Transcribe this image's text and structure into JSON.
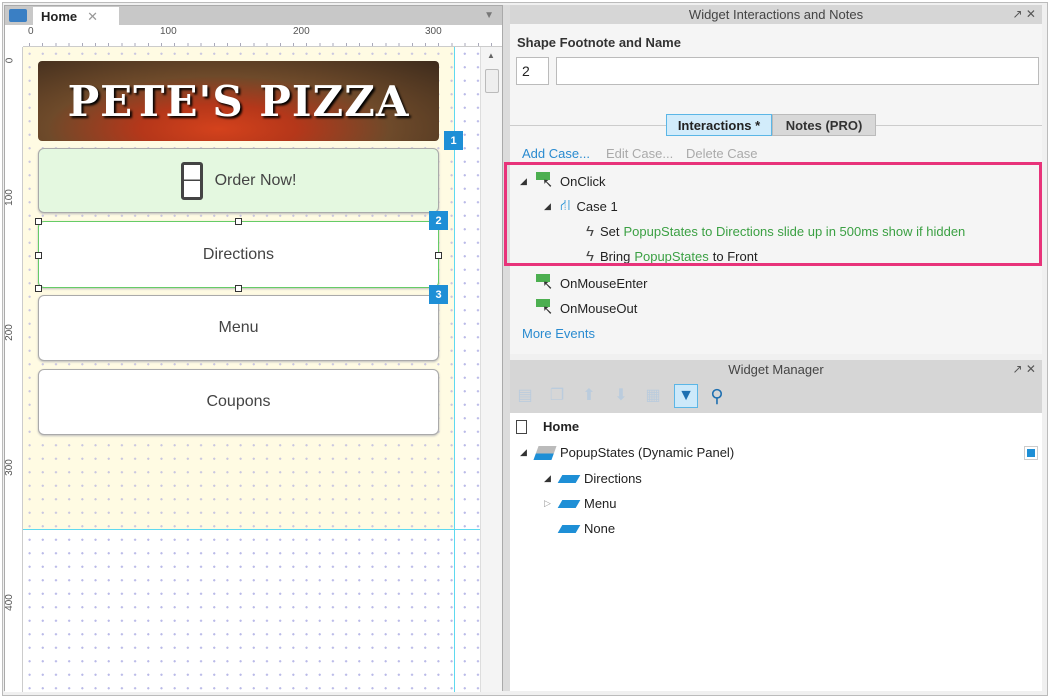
{
  "canvas": {
    "tab_label": "Home",
    "ruler_top": [
      "0",
      "100",
      "200",
      "300"
    ],
    "ruler_left": [
      "0",
      "100",
      "200",
      "300",
      "400"
    ],
    "banner_text": "PETE'S PIZZA",
    "buttons": [
      "Order Now!",
      "Directions",
      "Menu",
      "Coupons"
    ],
    "badges": [
      "1",
      "2",
      "3"
    ]
  },
  "interactions": {
    "title": "Widget Interactions and Notes",
    "footnote_label": "Shape Footnote and Name",
    "footnote_value": "2",
    "name_value": "",
    "tabs": [
      "Interactions *",
      "Notes (PRO)"
    ],
    "actions": [
      "Add Case...",
      "Edit Case...",
      "Delete Case"
    ],
    "onclick": "OnClick",
    "case": "Case 1",
    "action1": {
      "verb": "Set",
      "detail": "PopupStates to Directions slide up in 500ms show if hidden"
    },
    "action2": {
      "verb": "Bring",
      "target": "PopupStates",
      "rest": "to Front"
    },
    "events": [
      "OnMouseEnter",
      "OnMouseOut"
    ],
    "more": "More Events"
  },
  "widget_manager": {
    "title": "Widget Manager",
    "page": "Home",
    "panel": "PopupStates (Dynamic Panel)",
    "states": [
      "Directions",
      "Menu",
      "None"
    ]
  },
  "colors": {
    "accent": "#1e8fd6",
    "highlight": "#e8337a",
    "green": "#3ba043"
  }
}
